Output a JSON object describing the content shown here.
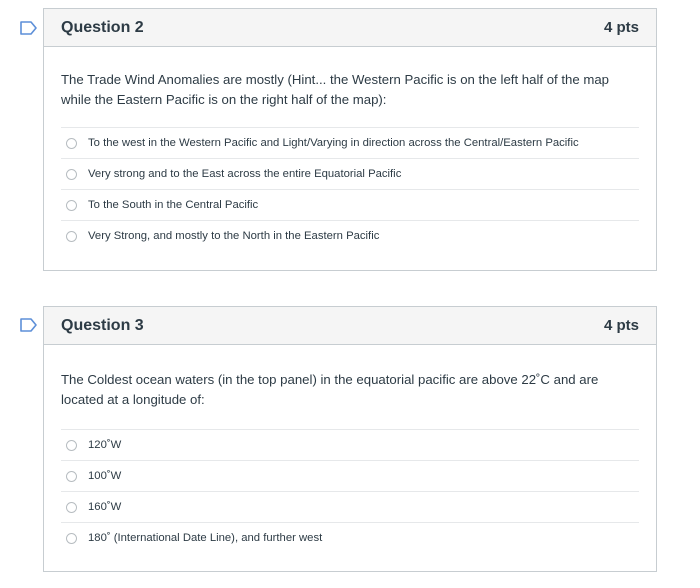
{
  "questions": [
    {
      "title": "Question 2",
      "points": "4 pts",
      "text": "The Trade Wind Anomalies are mostly (Hint... the Western Pacific is on the left half of the map while the Eastern Pacific is on the right half of the map):",
      "answers": [
        "To the west in the Western Pacific and Light/Varying in direction across the Central/Eastern Pacific",
        "Very strong and to the East across the entire Equatorial Pacific",
        "To the South in the Central Pacific",
        "Very Strong, and mostly to the North in the Eastern Pacific"
      ]
    },
    {
      "title": "Question 3",
      "points": "4 pts",
      "text": "The Coldest ocean waters (in the top panel) in the equatorial pacific are above 22˚C and are located at a longitude of:",
      "answers": [
        "120˚W",
        "100˚W",
        "160˚W",
        "180˚ (International Date Line), and further west"
      ]
    }
  ],
  "icons": {
    "flag": "bookmark-flag-icon",
    "radio": "radio-button-icon"
  },
  "colors": {
    "flag": "#5d8fd8",
    "header_bg": "#f5f5f5",
    "border": "#c7cdd1"
  }
}
